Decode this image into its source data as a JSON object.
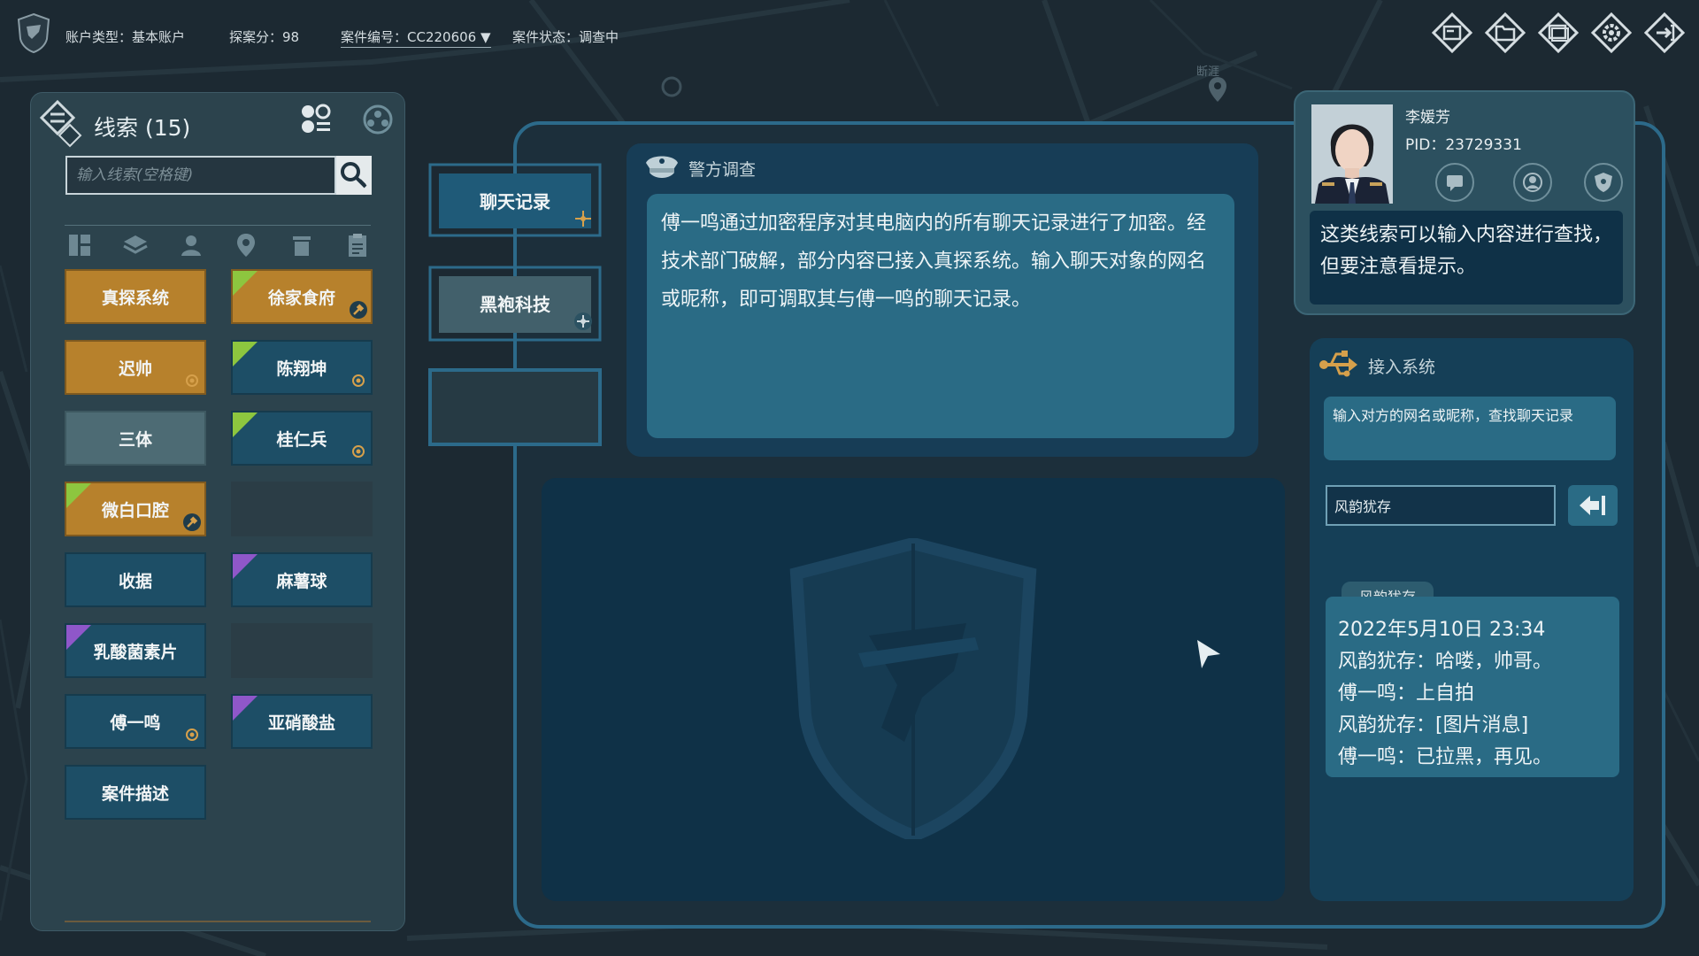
{
  "topbar": {
    "account_type": "账户类型：基本账户",
    "score": "探案分：98",
    "case_id": "案件编号：CC220606 ▼",
    "case_status": "案件状态：调查中",
    "icons": [
      "case-file-icon",
      "folder-icon",
      "screen-icon",
      "settings-gear-icon",
      "exit-icon"
    ]
  },
  "map": {
    "label": "断涯"
  },
  "clues": {
    "title": "线索 (15)",
    "search_placeholder": "输入线索(空格键)",
    "filters": [
      "category-icon",
      "layers-icon",
      "person-icon",
      "location-icon",
      "bin-icon",
      "clipboard-icon"
    ],
    "items": [
      {
        "label": "真探系统",
        "style": "gold",
        "corner": ""
      },
      {
        "label": "徐家食府",
        "style": "gold",
        "corner": "green"
      },
      {
        "label": "迟帅",
        "style": "gold",
        "corner": ""
      },
      {
        "label": "陈翔坤",
        "style": "teal",
        "corner": "green"
      },
      {
        "label": "三体",
        "style": "grey",
        "corner": ""
      },
      {
        "label": "桂仁兵",
        "style": "teal",
        "corner": "green"
      },
      {
        "label": "微白口腔",
        "style": "gold",
        "corner": "green"
      },
      {
        "label": "",
        "style": "empty",
        "corner": ""
      },
      {
        "label": "收据",
        "style": "teal",
        "corner": ""
      },
      {
        "label": "麻薯球",
        "style": "teal",
        "corner": "purple"
      },
      {
        "label": "乳酸菌素片",
        "style": "teal",
        "corner": "purple"
      },
      {
        "label": "",
        "style": "empty",
        "corner": ""
      },
      {
        "label": "傅一鸣",
        "style": "teal",
        "corner": ""
      },
      {
        "label": "亚硝酸盐",
        "style": "teal",
        "corner": "purple"
      },
      {
        "label": "案件描述",
        "style": "teal",
        "corner": ""
      }
    ]
  },
  "tabs": [
    {
      "label": "聊天记录",
      "active": true
    },
    {
      "label": "黑袍科技",
      "active": false
    },
    {
      "label": "",
      "active": false
    }
  ],
  "investigation": {
    "title": "警方调查",
    "body": "傅一鸣通过加密程序对其电脑内的所有聊天记录进行了加密。经技术部门破解，部分内容已接入真探系统。输入聊天对象的网名或昵称，即可调取其与傅一鸣的聊天记录。"
  },
  "profile": {
    "name": "李媛芳",
    "pid": "PID：23729331",
    "hint": "这类线索可以输入内容进行查找，但要注意看提示。"
  },
  "access": {
    "title": "接入系统",
    "description": "输入对方的网名或昵称，查找聊天记录",
    "input_value": "风韵犹存",
    "result_tag": "风韵犹存",
    "chat_lines": [
      "2022年5月10日 23:34",
      "风韵犹存：哈喽，帅哥。",
      "傅一鸣：上自拍",
      "风韵犹存：[图片消息]",
      "傅一鸣：已拉黑，再见。"
    ]
  },
  "colors": {
    "accent_gold": "#b7812c",
    "accent_teal": "#1d4e66",
    "frame_blue": "#2c6a8a",
    "corner_green": "#8dc63f",
    "corner_purple": "#8f57c9"
  }
}
